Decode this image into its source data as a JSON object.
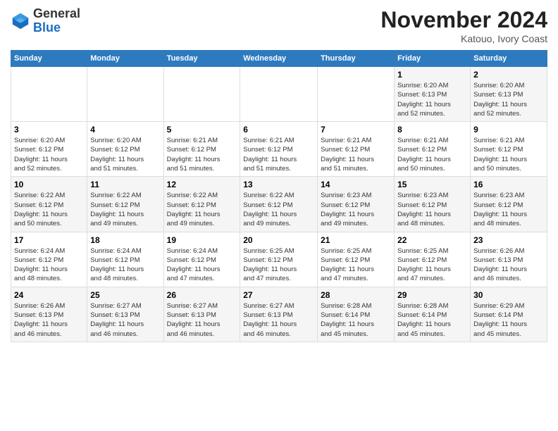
{
  "header": {
    "logo_line1": "General",
    "logo_line2": "Blue",
    "month": "November 2024",
    "location": "Katouo, Ivory Coast"
  },
  "days_of_week": [
    "Sunday",
    "Monday",
    "Tuesday",
    "Wednesday",
    "Thursday",
    "Friday",
    "Saturday"
  ],
  "weeks": [
    [
      {
        "day": "",
        "info": ""
      },
      {
        "day": "",
        "info": ""
      },
      {
        "day": "",
        "info": ""
      },
      {
        "day": "",
        "info": ""
      },
      {
        "day": "",
        "info": ""
      },
      {
        "day": "1",
        "info": "Sunrise: 6:20 AM\nSunset: 6:13 PM\nDaylight: 11 hours\nand 52 minutes."
      },
      {
        "day": "2",
        "info": "Sunrise: 6:20 AM\nSunset: 6:13 PM\nDaylight: 11 hours\nand 52 minutes."
      }
    ],
    [
      {
        "day": "3",
        "info": "Sunrise: 6:20 AM\nSunset: 6:12 PM\nDaylight: 11 hours\nand 52 minutes."
      },
      {
        "day": "4",
        "info": "Sunrise: 6:20 AM\nSunset: 6:12 PM\nDaylight: 11 hours\nand 51 minutes."
      },
      {
        "day": "5",
        "info": "Sunrise: 6:21 AM\nSunset: 6:12 PM\nDaylight: 11 hours\nand 51 minutes."
      },
      {
        "day": "6",
        "info": "Sunrise: 6:21 AM\nSunset: 6:12 PM\nDaylight: 11 hours\nand 51 minutes."
      },
      {
        "day": "7",
        "info": "Sunrise: 6:21 AM\nSunset: 6:12 PM\nDaylight: 11 hours\nand 51 minutes."
      },
      {
        "day": "8",
        "info": "Sunrise: 6:21 AM\nSunset: 6:12 PM\nDaylight: 11 hours\nand 50 minutes."
      },
      {
        "day": "9",
        "info": "Sunrise: 6:21 AM\nSunset: 6:12 PM\nDaylight: 11 hours\nand 50 minutes."
      }
    ],
    [
      {
        "day": "10",
        "info": "Sunrise: 6:22 AM\nSunset: 6:12 PM\nDaylight: 11 hours\nand 50 minutes."
      },
      {
        "day": "11",
        "info": "Sunrise: 6:22 AM\nSunset: 6:12 PM\nDaylight: 11 hours\nand 49 minutes."
      },
      {
        "day": "12",
        "info": "Sunrise: 6:22 AM\nSunset: 6:12 PM\nDaylight: 11 hours\nand 49 minutes."
      },
      {
        "day": "13",
        "info": "Sunrise: 6:22 AM\nSunset: 6:12 PM\nDaylight: 11 hours\nand 49 minutes."
      },
      {
        "day": "14",
        "info": "Sunrise: 6:23 AM\nSunset: 6:12 PM\nDaylight: 11 hours\nand 49 minutes."
      },
      {
        "day": "15",
        "info": "Sunrise: 6:23 AM\nSunset: 6:12 PM\nDaylight: 11 hours\nand 48 minutes."
      },
      {
        "day": "16",
        "info": "Sunrise: 6:23 AM\nSunset: 6:12 PM\nDaylight: 11 hours\nand 48 minutes."
      }
    ],
    [
      {
        "day": "17",
        "info": "Sunrise: 6:24 AM\nSunset: 6:12 PM\nDaylight: 11 hours\nand 48 minutes."
      },
      {
        "day": "18",
        "info": "Sunrise: 6:24 AM\nSunset: 6:12 PM\nDaylight: 11 hours\nand 48 minutes."
      },
      {
        "day": "19",
        "info": "Sunrise: 6:24 AM\nSunset: 6:12 PM\nDaylight: 11 hours\nand 47 minutes."
      },
      {
        "day": "20",
        "info": "Sunrise: 6:25 AM\nSunset: 6:12 PM\nDaylight: 11 hours\nand 47 minutes."
      },
      {
        "day": "21",
        "info": "Sunrise: 6:25 AM\nSunset: 6:12 PM\nDaylight: 11 hours\nand 47 minutes."
      },
      {
        "day": "22",
        "info": "Sunrise: 6:25 AM\nSunset: 6:12 PM\nDaylight: 11 hours\nand 47 minutes."
      },
      {
        "day": "23",
        "info": "Sunrise: 6:26 AM\nSunset: 6:13 PM\nDaylight: 11 hours\nand 46 minutes."
      }
    ],
    [
      {
        "day": "24",
        "info": "Sunrise: 6:26 AM\nSunset: 6:13 PM\nDaylight: 11 hours\nand 46 minutes."
      },
      {
        "day": "25",
        "info": "Sunrise: 6:27 AM\nSunset: 6:13 PM\nDaylight: 11 hours\nand 46 minutes."
      },
      {
        "day": "26",
        "info": "Sunrise: 6:27 AM\nSunset: 6:13 PM\nDaylight: 11 hours\nand 46 minutes."
      },
      {
        "day": "27",
        "info": "Sunrise: 6:27 AM\nSunset: 6:13 PM\nDaylight: 11 hours\nand 46 minutes."
      },
      {
        "day": "28",
        "info": "Sunrise: 6:28 AM\nSunset: 6:14 PM\nDaylight: 11 hours\nand 45 minutes."
      },
      {
        "day": "29",
        "info": "Sunrise: 6:28 AM\nSunset: 6:14 PM\nDaylight: 11 hours\nand 45 minutes."
      },
      {
        "day": "30",
        "info": "Sunrise: 6:29 AM\nSunset: 6:14 PM\nDaylight: 11 hours\nand 45 minutes."
      }
    ]
  ]
}
